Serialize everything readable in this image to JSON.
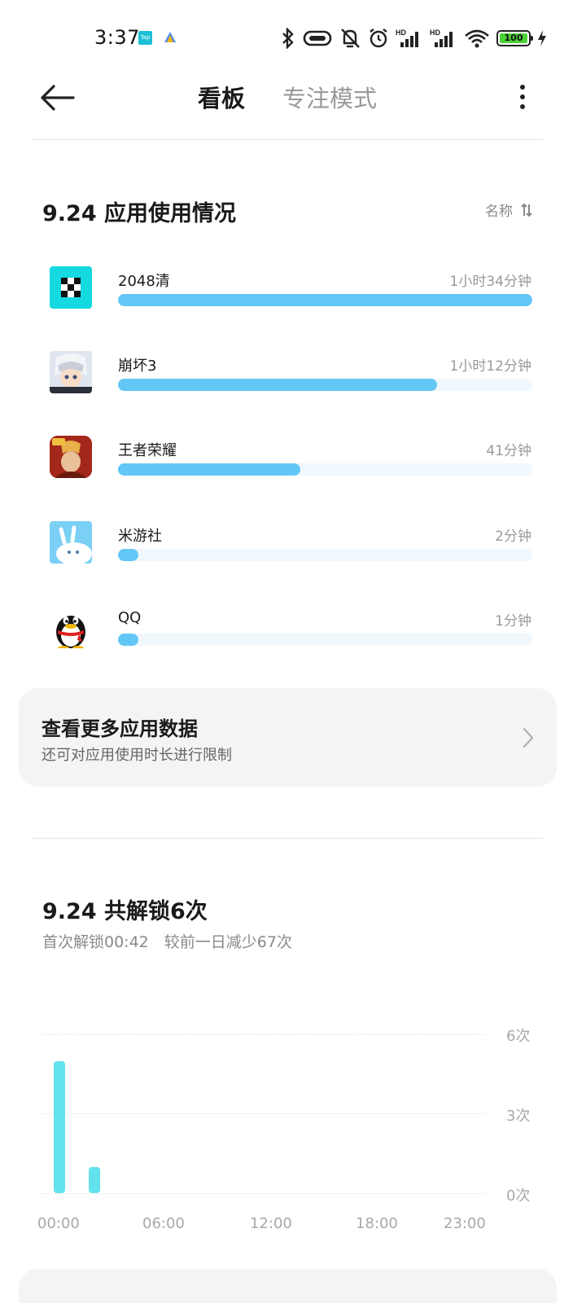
{
  "status_bar": {
    "time": "3:37",
    "notif_tap": "Tap",
    "battery": "100"
  },
  "header": {
    "tabs": [
      {
        "label": "看板",
        "active": true
      },
      {
        "label": "专注模式",
        "active": false
      }
    ]
  },
  "usage": {
    "title": "9.24 应用使用情况",
    "sort_label": "名称",
    "bar_color": "#63c7f6",
    "apps": [
      {
        "name": "2048清",
        "time": "1小时34分钟",
        "fraction": 1.0,
        "icon": "2048-game-icon"
      },
      {
        "name": "崩坏3",
        "time": "1小时12分钟",
        "fraction": 0.77,
        "icon": "honkai-impact-icon"
      },
      {
        "name": "王者荣耀",
        "time": "41分钟",
        "fraction": 0.44,
        "icon": "honor-of-kings-icon"
      },
      {
        "name": "米游社",
        "time": "2分钟",
        "fraction": 0.05,
        "icon": "miyoushe-icon"
      },
      {
        "name": "QQ",
        "time": "1分钟",
        "fraction": 0.05,
        "icon": "qq-penguin-icon"
      }
    ]
  },
  "more_card": {
    "title": "查看更多应用数据",
    "subtitle": "还可对应用使用时长进行限制"
  },
  "unlock": {
    "title": "9.24 共解锁6次",
    "subtitle": "首次解锁00:42　较前一日减少67次"
  },
  "chart_data": {
    "type": "bar",
    "x_tick_labels": [
      "00:00",
      "06:00",
      "12:00",
      "18:00",
      "23:00"
    ],
    "y_tick_labels": [
      "6次",
      "3次",
      "0次"
    ],
    "ylim": [
      0,
      6
    ],
    "grid": true,
    "bar_color": "#62e2ec",
    "bars": [
      {
        "hour": 0,
        "value": 5
      },
      {
        "hour": 2,
        "value": 1
      }
    ]
  }
}
